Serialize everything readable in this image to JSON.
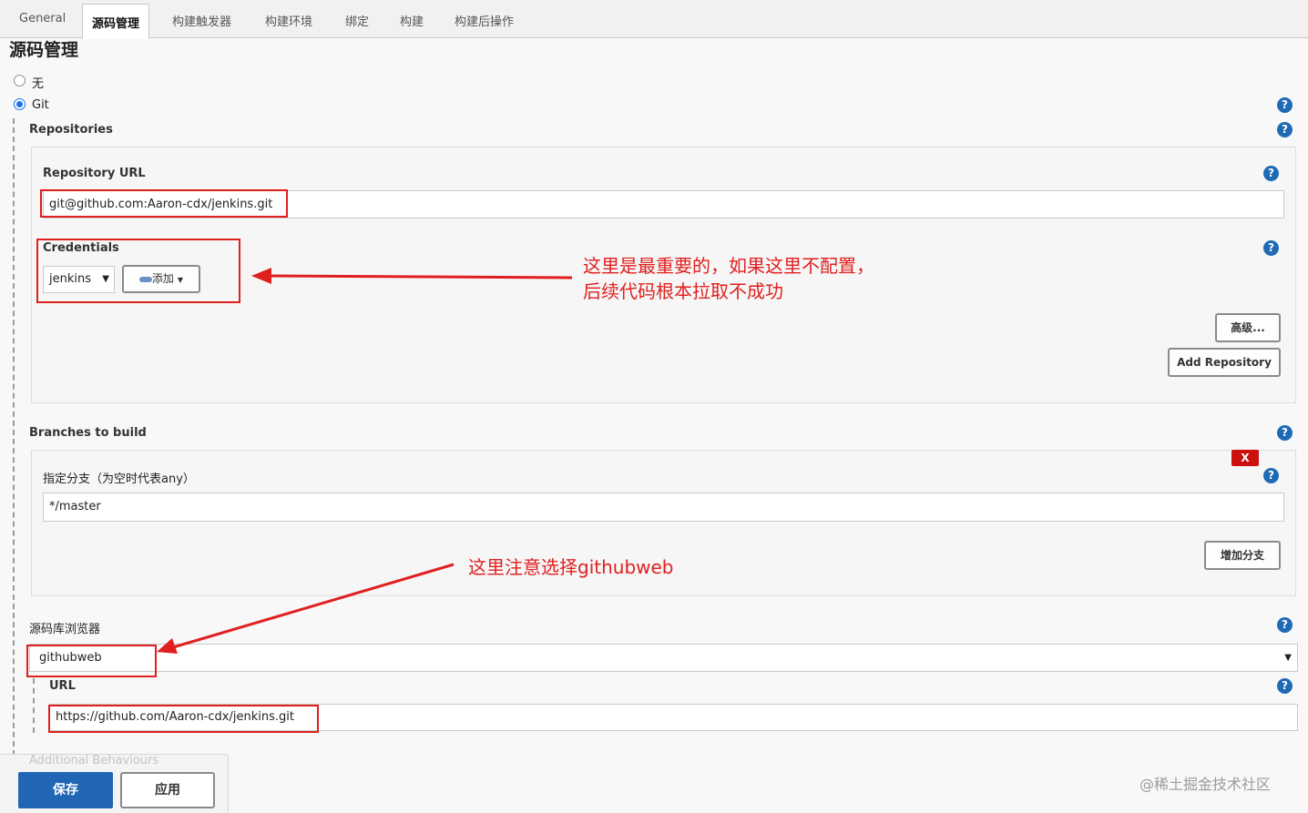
{
  "tabs": [
    {
      "label": "General",
      "active": false
    },
    {
      "label": "源码管理",
      "active": true
    },
    {
      "label": "构建触发器",
      "active": false
    },
    {
      "label": "构建环境",
      "active": false
    },
    {
      "label": "绑定",
      "active": false
    },
    {
      "label": "构建",
      "active": false
    },
    {
      "label": "构建后操作",
      "active": false
    }
  ],
  "page_title": "源码管理",
  "scm_options": {
    "none_label": "无",
    "git_label": "Git",
    "selected": "Git"
  },
  "repositories": {
    "label": "Repositories",
    "url_label": "Repository URL",
    "url_value": "git@github.com:Aaron-cdx/jenkins.git",
    "credentials_label": "Credentials",
    "credentials_value": "jenkins",
    "add_label": "添加",
    "advanced_label": "高级...",
    "add_repository_label": "Add Repository"
  },
  "branches": {
    "label": "Branches to build",
    "delete_label": "X",
    "specifier_label": "指定分支（为空时代表any）",
    "specifier_value": "*/master",
    "add_branch_label": "增加分支"
  },
  "browser": {
    "label": "源码库浏览器",
    "value": "githubweb",
    "url_label": "URL",
    "url_value": "https://github.com/Aaron-cdx/jenkins.git"
  },
  "additional_behaviours_label": "Additional Behaviours",
  "footer": {
    "save_label": "保存",
    "apply_label": "应用"
  },
  "annotations": {
    "credentials_note_line1": "这里是最重要的，如果这里不配置，",
    "credentials_note_line2": "后续代码根本拉取不成功",
    "browser_note": "这里注意选择githubweb"
  },
  "watermark": "@稀土掘金技术社区",
  "colors": {
    "accent": "#2166b4",
    "annotation": "#e11f1f",
    "help": "#1e6ab5",
    "delete": "#cc1010"
  }
}
